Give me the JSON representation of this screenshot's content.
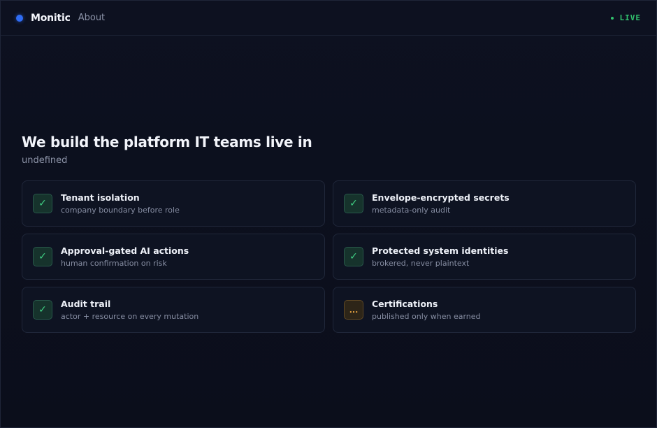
{
  "header": {
    "brand": "Monitic",
    "nav_about": "About",
    "status": "LIVE",
    "colors": {
      "brand_dot": "#2f6cf4",
      "status": "#31c36e"
    }
  },
  "hero": {
    "title": "We build the platform IT teams live in",
    "subtitle": "undefined"
  },
  "features": [
    {
      "title": "Tenant isolation",
      "subtitle": "company boundary before role",
      "status": "done",
      "icon": "check-icon",
      "glyph": "✓"
    },
    {
      "title": "Envelope-encrypted secrets",
      "subtitle": "metadata-only audit",
      "status": "done",
      "icon": "check-icon",
      "glyph": "✓"
    },
    {
      "title": "Approval-gated AI actions",
      "subtitle": "human confirmation on risk",
      "status": "done",
      "icon": "check-icon",
      "glyph": "✓"
    },
    {
      "title": "Protected system identities",
      "subtitle": "brokered, never plaintext",
      "status": "done",
      "icon": "check-icon",
      "glyph": "✓"
    },
    {
      "title": "Audit trail",
      "subtitle": "actor + resource on every mutation",
      "status": "done",
      "icon": "check-icon",
      "glyph": "✓"
    },
    {
      "title": "Certifications",
      "subtitle": "published only when earned",
      "status": "pending",
      "icon": "ellipsis-icon",
      "glyph": "..."
    }
  ]
}
